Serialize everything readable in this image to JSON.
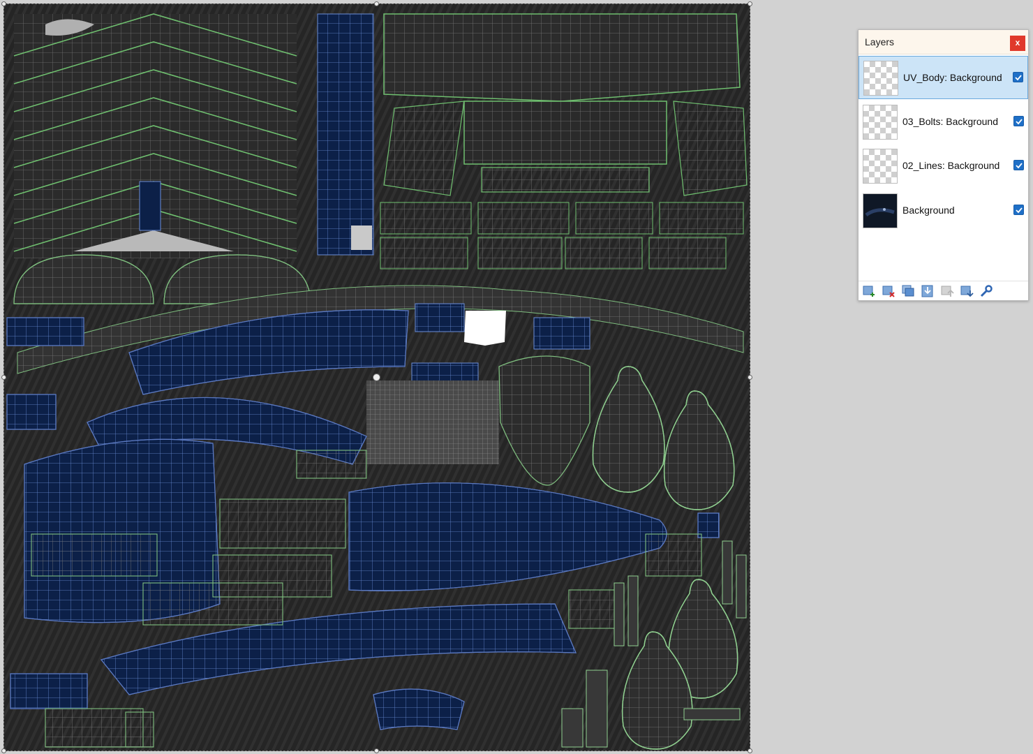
{
  "layers_panel": {
    "title": "Layers",
    "close_label": "x",
    "layers": [
      {
        "name": "UV_Body: Background",
        "visible": true,
        "selected": true,
        "thumbnail": "transparent"
      },
      {
        "name": "03_Bolts: Background",
        "visible": true,
        "selected": false,
        "thumbnail": "transparent"
      },
      {
        "name": "02_Lines: Background",
        "visible": true,
        "selected": false,
        "thumbnail": "transparent"
      },
      {
        "name": "Background",
        "visible": true,
        "selected": false,
        "thumbnail": "dark-texture"
      }
    ],
    "toolbar": [
      {
        "icon": "add-layer-icon"
      },
      {
        "icon": "delete-layer-icon"
      },
      {
        "icon": "duplicate-layer-icon"
      },
      {
        "icon": "merge-layer-down-icon"
      },
      {
        "icon": "move-layer-up-icon"
      },
      {
        "icon": "move-layer-down-icon"
      },
      {
        "icon": "layer-properties-icon"
      }
    ]
  },
  "canvas": {
    "content": "uv-texture-map",
    "colors": {
      "background": "#2a2a2a",
      "blue_islands": "#0c2048",
      "wire_green": "#5fae5f",
      "wire_grey": "#8a8a8a",
      "wire_blue": "#6b8ed8"
    }
  }
}
